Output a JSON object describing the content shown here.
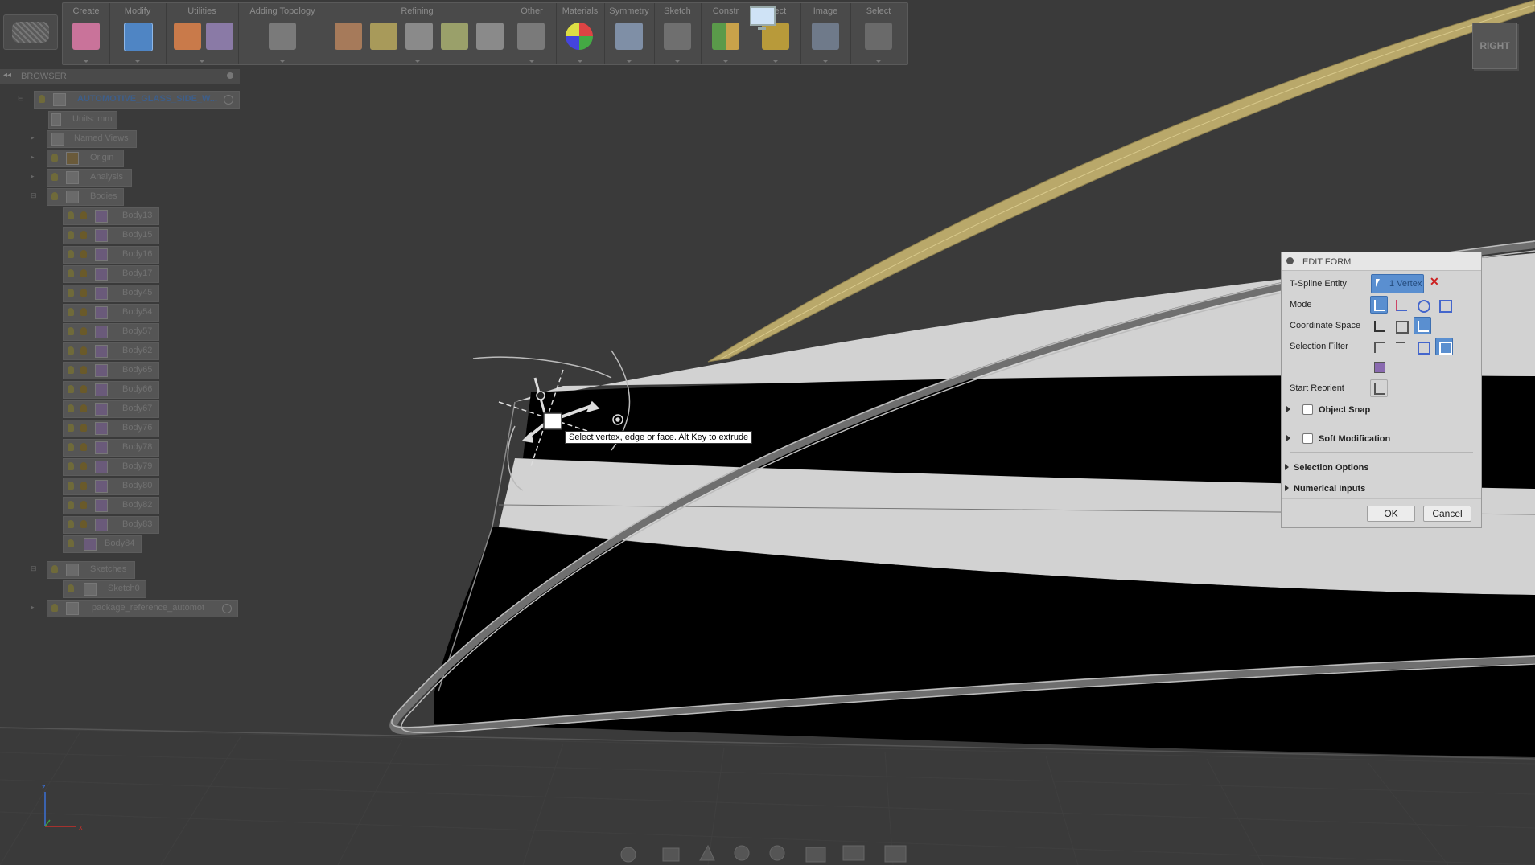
{
  "toolbar": {
    "groups": [
      {
        "label": "Create"
      },
      {
        "label": "Modify"
      },
      {
        "label": "Utilities"
      },
      {
        "label": "Adding Topology"
      },
      {
        "label": "Refining"
      },
      {
        "label": "Other"
      },
      {
        "label": "Materials"
      },
      {
        "label": "Symmetry"
      },
      {
        "label": "Sketch"
      },
      {
        "label": "Constr"
      },
      {
        "label": "spect"
      },
      {
        "label": "Image"
      },
      {
        "label": "Select"
      }
    ]
  },
  "viewcube": {
    "face": "RIGHT"
  },
  "browser": {
    "title": "BROWSER",
    "root": "AUTOMOTIVE_GLASS_SIDE_W...",
    "items": {
      "units": "Units: mm",
      "named_views": "Named Views",
      "origin": "Origin",
      "analysis": "Analysis",
      "bodies": "Bodies",
      "sketches": "Sketches",
      "sketch0": "Sketch0",
      "package_ref": "package_reference_automot"
    },
    "bodies": [
      "Body13",
      "Body15",
      "Body16",
      "Body17",
      "Body45",
      "Body54",
      "Body57",
      "Body62",
      "Body65",
      "Body66",
      "Body67",
      "Body76",
      "Body78",
      "Body79",
      "Body80",
      "Body82",
      "Body83",
      "Body84"
    ]
  },
  "tooltip": "Select vertex, edge or face. Alt Key to extrude",
  "edit_form": {
    "title": "EDIT FORM",
    "tspline_label": "T-Spline Entity",
    "tspline_value": "1 Vertex",
    "mode_label": "Mode",
    "coord_label": "Coordinate Space",
    "filter_label": "Selection Filter",
    "reorient_label": "Start Reorient",
    "object_snap": "Object Snap",
    "soft_mod": "Soft Modification",
    "selection_options": "Selection Options",
    "numerical_inputs": "Numerical Inputs",
    "ok": "OK",
    "cancel": "Cancel"
  },
  "colors": {
    "background": "#3a3a3a",
    "glass_black": "#000000",
    "glass_white": "#d2d2d2",
    "trim_gold": "#b9a86a",
    "accent_blue": "#5a8fd0"
  }
}
